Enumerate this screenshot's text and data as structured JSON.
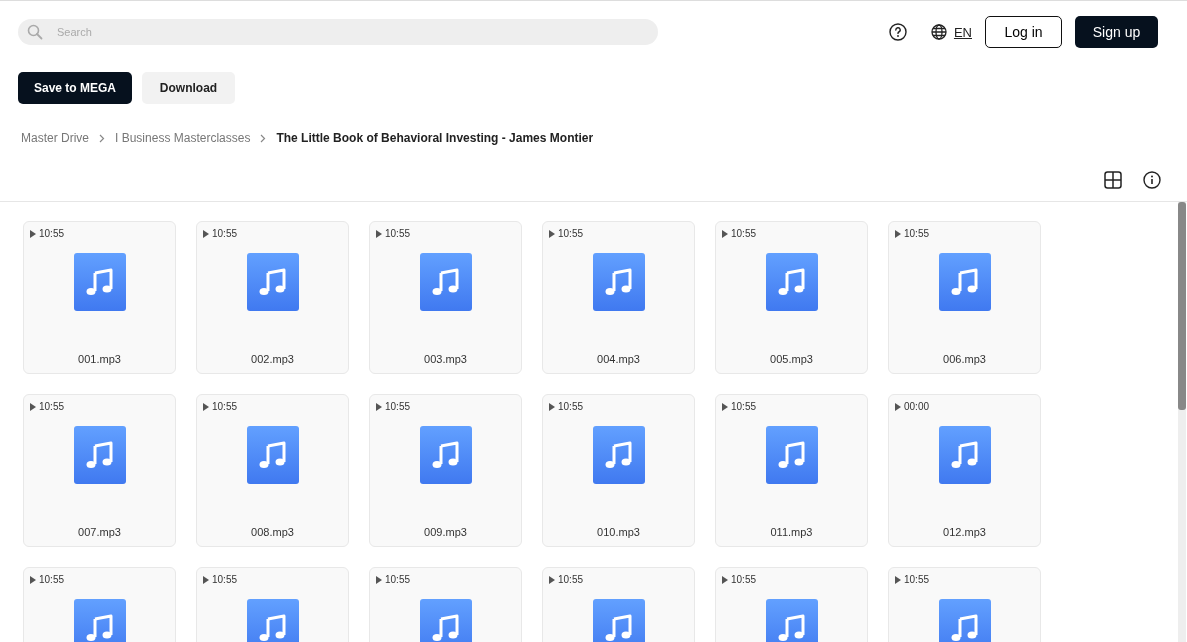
{
  "search": {
    "placeholder": "Search"
  },
  "language": "EN",
  "auth_buttons": [
    "Log in",
    "Sign up"
  ],
  "actions": [
    "Save to MEGA",
    "Download"
  ],
  "breadcrumb": [
    {
      "label": "Master Drive",
      "current": false
    },
    {
      "label": "I Business Masterclasses",
      "current": false
    },
    {
      "label": "The Little Book of Behavioral Investing - James Montier",
      "current": true
    }
  ],
  "files": [
    {
      "duration": "10:55",
      "name": "001.mp3"
    },
    {
      "duration": "10:55",
      "name": "002.mp3"
    },
    {
      "duration": "10:55",
      "name": "003.mp3"
    },
    {
      "duration": "10:55",
      "name": "004.mp3"
    },
    {
      "duration": "10:55",
      "name": "005.mp3"
    },
    {
      "duration": "10:55",
      "name": "006.mp3"
    },
    {
      "duration": "10:55",
      "name": "007.mp3"
    },
    {
      "duration": "10:55",
      "name": "008.mp3"
    },
    {
      "duration": "10:55",
      "name": "009.mp3"
    },
    {
      "duration": "10:55",
      "name": "010.mp3"
    },
    {
      "duration": "10:55",
      "name": "011.mp3"
    },
    {
      "duration": "00:00",
      "name": "012.mp3"
    },
    {
      "duration": "10:55"
    },
    {
      "duration": "10:55"
    },
    {
      "duration": "10:55"
    },
    {
      "duration": "10:55"
    },
    {
      "duration": "10:55"
    },
    {
      "duration": "10:55"
    }
  ]
}
